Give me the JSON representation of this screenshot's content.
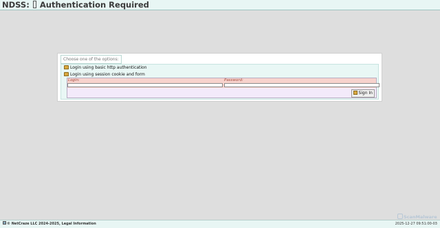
{
  "header": {
    "title_prefix": "NDSS:",
    "title_text": "Authentication Required"
  },
  "card": {
    "legend": "Choose one of the options:",
    "option_basic": "Login using basic http authentication",
    "option_session": "Login using session cookie and form",
    "form": {
      "login_label": "Login:",
      "password_label": "Password:",
      "login_value": "",
      "password_value": "",
      "submit_label": "Sign In"
    }
  },
  "footer": {
    "copyright": "© NetCraze LLC 2024-2025, Legal Information",
    "timestamp": "2025-12-27 09:51:00-03"
  },
  "watermark": {
    "text": "ScanMalware"
  },
  "colors": {
    "header_bg": "#e8f6f4",
    "body_bg": "#dedede",
    "fields_bg": "#f7d3cd",
    "form_bg": "#f3eafa"
  },
  "icons": {
    "folder": "folder-icon",
    "key": "key-icon",
    "hand": "hand-icon"
  }
}
